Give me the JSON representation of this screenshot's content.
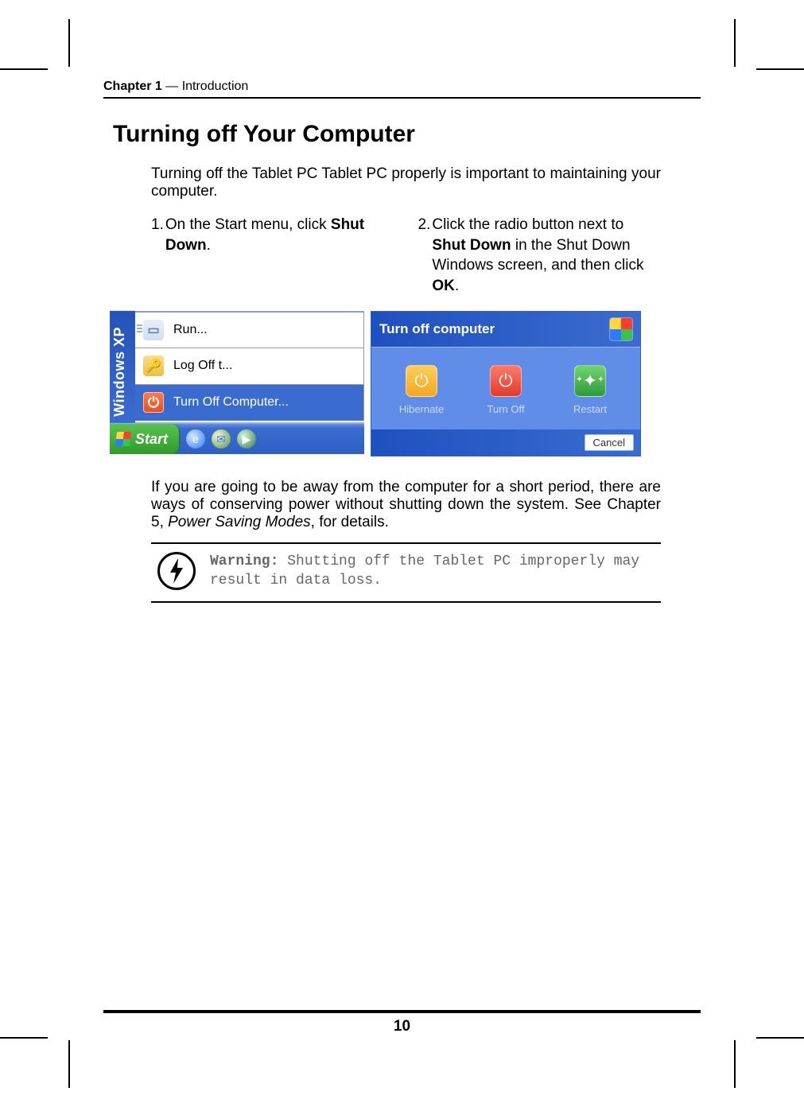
{
  "header": {
    "chapter": "Chapter 1",
    "sep": " — ",
    "name": "Introduction"
  },
  "title": "Turning off Your Computer",
  "intro": "Turning off the Tablet PC Tablet PC properly is important to maintaining your computer.",
  "steps": [
    {
      "num": "1.",
      "pre": "On the Start menu, click ",
      "bold": "Shut Down",
      "post": "."
    },
    {
      "num": "2.",
      "pre": "Click the radio button next to ",
      "bold": "Shut Down",
      "mid": " in the Shut Down Windows screen, and then click ",
      "bold2": "OK",
      "post": "."
    }
  ],
  "left": {
    "strip": "Windows XP",
    "items": [
      {
        "label": "Run...",
        "selected": false,
        "icon": "run"
      },
      {
        "label": "Log Off t...",
        "selected": false,
        "icon": "logoff"
      },
      {
        "label": "Turn Off Computer...",
        "selected": true,
        "icon": "turnoff"
      }
    ],
    "start": "Start"
  },
  "right": {
    "title": "Turn off computer",
    "options": [
      {
        "label": "Hibernate",
        "kind": "hib",
        "glyph": "⏻"
      },
      {
        "label": "Turn Off",
        "kind": "off",
        "glyph": "⏻"
      },
      {
        "label": "Restart",
        "kind": "res",
        "glyph": "✦"
      }
    ],
    "cancel": "Cancel"
  },
  "post": {
    "a": "If you are going to be away from the computer for a short period, there are ways of conserving power without shutting down the system. See Chapter 5, ",
    "b": "Power Saving Modes",
    "c": ", for details."
  },
  "warning": {
    "label": "Warning:",
    "text": " Shutting off the Tablet PC improperly may result in data loss."
  },
  "page_number": "10"
}
